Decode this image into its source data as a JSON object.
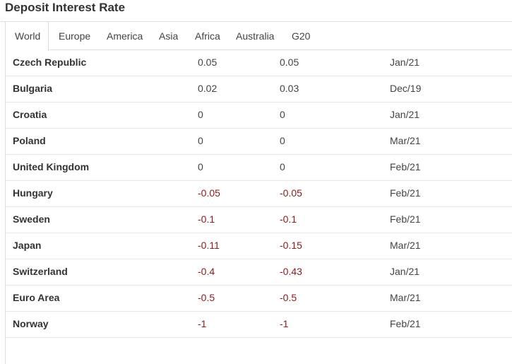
{
  "page": {
    "title": "Deposit Interest Rate"
  },
  "colors": {
    "negative": "#8b1a1a",
    "text": "#333333",
    "border": "#dddddd"
  },
  "tabs": [
    {
      "label": "World",
      "active": true
    },
    {
      "label": "Europe",
      "active": false
    },
    {
      "label": "America",
      "active": false
    },
    {
      "label": "Asia",
      "active": false
    },
    {
      "label": "Africa",
      "active": false
    },
    {
      "label": "Australia",
      "active": false
    },
    {
      "label": "G20",
      "active": false
    }
  ],
  "rows": [
    {
      "country": "Czech Republic",
      "last": "0.05",
      "previous": "0.05",
      "reference": "Jan/21",
      "negative": false
    },
    {
      "country": "Bulgaria",
      "last": "0.02",
      "previous": "0.03",
      "reference": "Dec/19",
      "negative": false
    },
    {
      "country": "Croatia",
      "last": "0",
      "previous": "0",
      "reference": "Jan/21",
      "negative": false
    },
    {
      "country": "Poland",
      "last": "0",
      "previous": "0",
      "reference": "Mar/21",
      "negative": false
    },
    {
      "country": "United Kingdom",
      "last": "0",
      "previous": "0",
      "reference": "Feb/21",
      "negative": false
    },
    {
      "country": "Hungary",
      "last": "-0.05",
      "previous": "-0.05",
      "reference": "Feb/21",
      "negative": true
    },
    {
      "country": "Sweden",
      "last": "-0.1",
      "previous": "-0.1",
      "reference": "Feb/21",
      "negative": true
    },
    {
      "country": "Japan",
      "last": "-0.11",
      "previous": "-0.15",
      "reference": "Mar/21",
      "negative": true
    },
    {
      "country": "Switzerland",
      "last": "-0.4",
      "previous": "-0.43",
      "reference": "Jan/21",
      "negative": true
    },
    {
      "country": "Euro Area",
      "last": "-0.5",
      "previous": "-0.5",
      "reference": "Mar/21",
      "negative": true
    },
    {
      "country": "Norway",
      "last": "-1",
      "previous": "-1",
      "reference": "Feb/21",
      "negative": true
    }
  ]
}
